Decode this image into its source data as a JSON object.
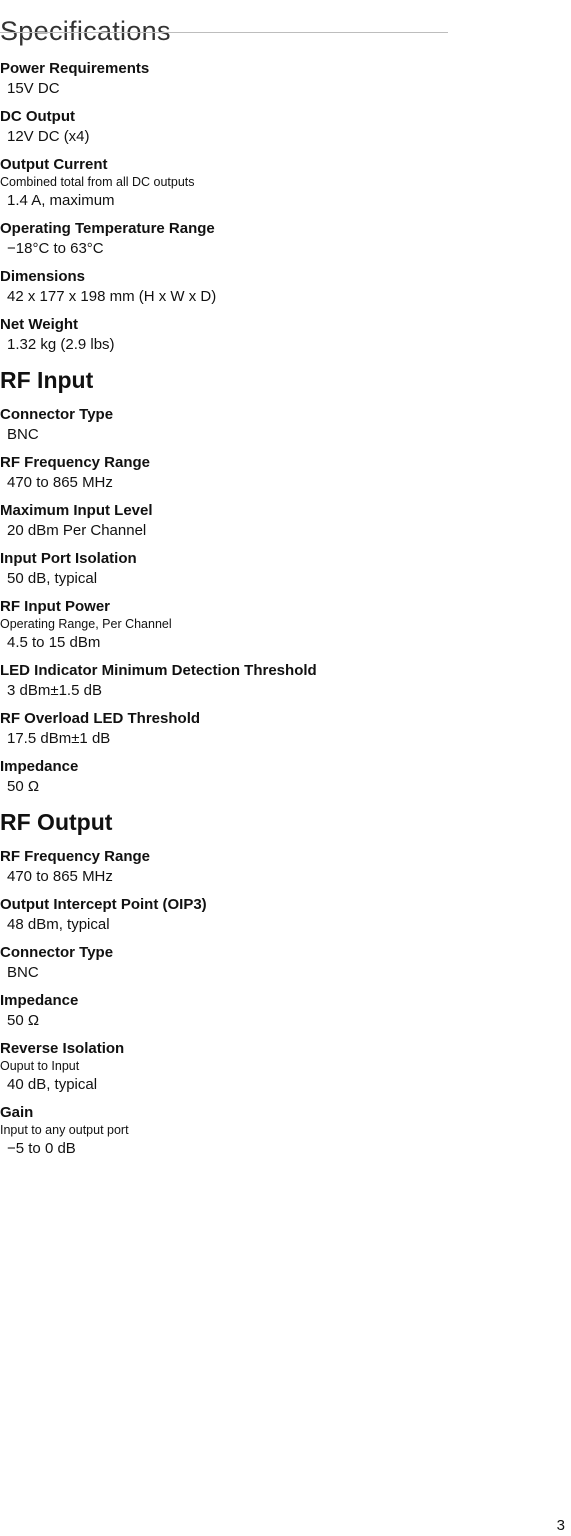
{
  "page": {
    "title": "Specifications",
    "page_number": "3"
  },
  "general": {
    "specs": [
      {
        "label": "Power Requirements",
        "note": "",
        "value": "15V DC"
      },
      {
        "label": "DC Output",
        "note": "",
        "value": "12V DC (x4)"
      },
      {
        "label": "Output Current",
        "note": "Combined total from all DC outputs",
        "value": "1.4 A, maximum"
      },
      {
        "label": "Operating Temperature Range",
        "note": "",
        "value": "−18°C to 63°C"
      },
      {
        "label": "Dimensions",
        "note": "",
        "value": "42 x 177 x 198 mm (H x W x D)"
      },
      {
        "label": "Net Weight",
        "note": "",
        "value": "1.32 kg (2.9 lbs)"
      }
    ]
  },
  "rf_input": {
    "heading": "RF Input",
    "specs": [
      {
        "label": "Connector Type",
        "note": "",
        "value": "BNC"
      },
      {
        "label": "RF Frequency Range",
        "note": "",
        "value": "470 to 865 MHz"
      },
      {
        "label": "Maximum Input Level",
        "note": "",
        "value": "20 dBm Per Channel"
      },
      {
        "label": "Input Port Isolation",
        "note": "",
        "value": "50 dB, typical"
      },
      {
        "label": "RF Input Power",
        "note": "Operating Range, Per Channel",
        "value": "4.5 to 15 dBm"
      },
      {
        "label": "LED Indicator Minimum Detection Threshold",
        "note": "",
        "value": "3 dBm±1.5 dB"
      },
      {
        "label": "RF Overload LED Threshold",
        "note": "",
        "value": "17.5 dBm±1 dB"
      },
      {
        "label": "Impedance",
        "note": "",
        "value": "50 Ω"
      }
    ]
  },
  "rf_output": {
    "heading": "RF Output",
    "specs": [
      {
        "label": "RF Frequency Range",
        "note": "",
        "value": "470 to 865 MHz"
      },
      {
        "label": "Output Intercept Point (OIP3)",
        "note": "",
        "value": "48 dBm, typical"
      },
      {
        "label": "Connector Type",
        "note": "",
        "value": "BNC"
      },
      {
        "label": "Impedance",
        "note": "",
        "value": "50 Ω"
      },
      {
        "label": "Reverse Isolation",
        "note": "Ouput to Input",
        "value": "40 dB, typical"
      },
      {
        "label": "Gain",
        "note": "Input to any output port",
        "value": "−5 to 0 dB"
      }
    ]
  }
}
